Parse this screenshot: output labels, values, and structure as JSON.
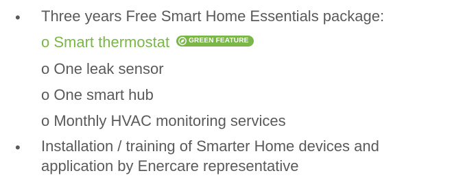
{
  "items": [
    {
      "text": "Three years Free Smart Home Essentials package:",
      "subitems": [
        {
          "text": "o Smart thermostat",
          "badge": {
            "label": "GREEN FEATURE",
            "icon": "leaf-icon",
            "color": "#7ab648"
          }
        },
        {
          "text": "o One leak sensor"
        },
        {
          "text": "o One smart hub"
        },
        {
          "text": "o Monthly HVAC monitoring services"
        }
      ]
    },
    {
      "lines": [
        "Installation / training of Smarter Home devices and",
        "application by Enercare representative"
      ]
    }
  ],
  "colors": {
    "text": "#5a5a5a",
    "accent_green": "#7ab648"
  }
}
